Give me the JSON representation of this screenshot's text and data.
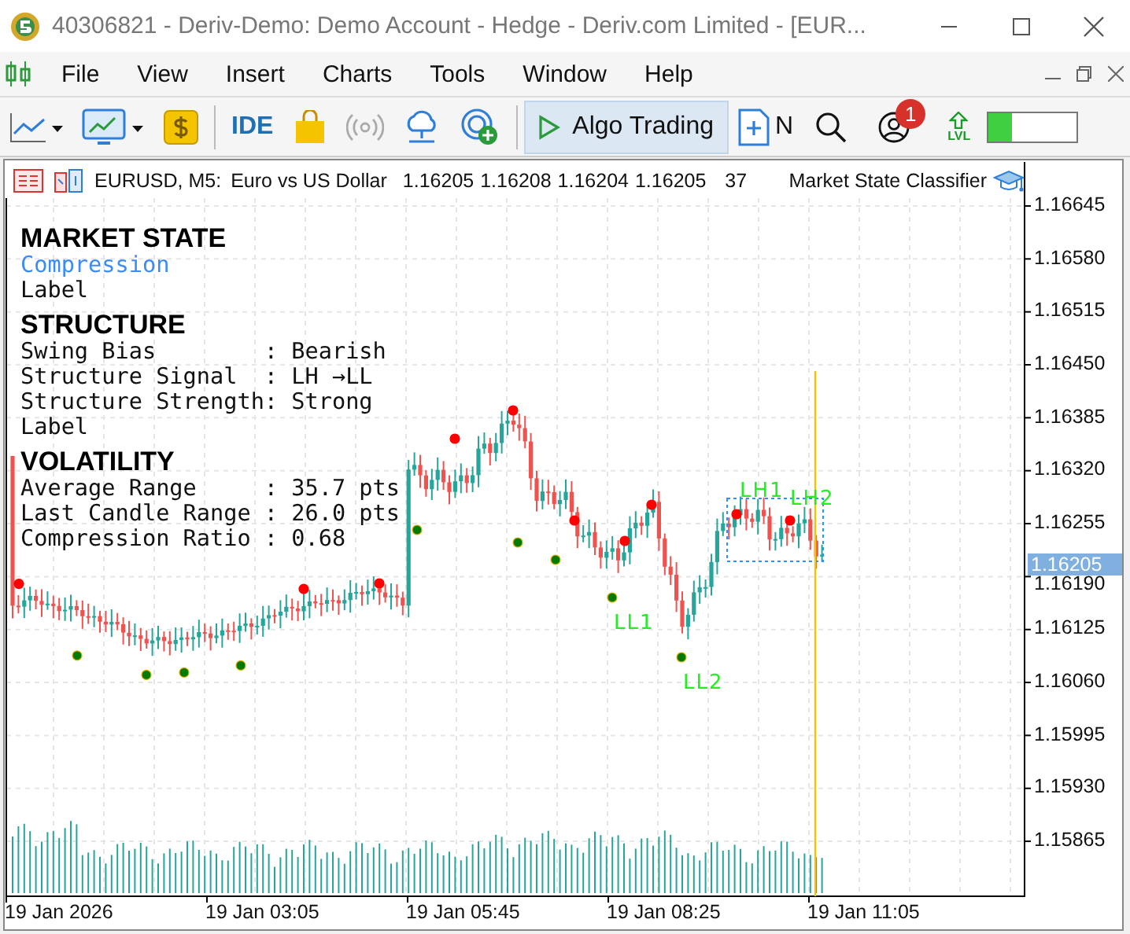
{
  "window": {
    "title": "40306821 - Deriv-Demo: Demo Account - Hedge - Deriv.com Limited - [EUR..."
  },
  "menu": [
    "File",
    "View",
    "Insert",
    "Charts",
    "Tools",
    "Window",
    "Help"
  ],
  "toolbar": {
    "ide_label": "IDE",
    "algo_trading": {
      "label": "Algo Trading",
      "selected": true
    },
    "new_order_label": "N",
    "notification_badge": "1",
    "lvl_label": "LVL",
    "meter": {
      "level": 0.28
    }
  },
  "chart": {
    "symbol": "EURUSD, M5:",
    "description": "Euro vs US Dollar",
    "quotes": [
      "1.16205",
      "1.16208",
      "1.16204",
      "1.16205"
    ],
    "tick_volume": "37",
    "indicator": "Market State Classifier",
    "price_axis": [
      "1.16645",
      "1.16580",
      "1.16515",
      "1.16450",
      "1.16385",
      "1.16320",
      "1.16255",
      "1.16190",
      "1.16125",
      "1.16060",
      "1.15995",
      "1.15930",
      "1.15865"
    ],
    "current_price": "1.16205",
    "time_axis": [
      "19 Jan 2026",
      "19 Jan 03:05",
      "19 Jan 05:45",
      "19 Jan 08:25",
      "19 Jan 11:05"
    ],
    "swing_labels": [
      "LH1",
      "LH2",
      "LL1",
      "LL2"
    ],
    "panel": [
      {
        "heading": "MARKET STATE",
        "lines": [
          {
            "kind": "state",
            "text": "Compression"
          },
          {
            "kind": "plain",
            "text": "Label"
          }
        ]
      },
      {
        "heading": "STRUCTURE",
        "lines": [
          {
            "kind": "plain",
            "text": "Swing Bias        : Bearish"
          },
          {
            "kind": "plain",
            "text": "Structure Signal  : LH →LL"
          },
          {
            "kind": "plain",
            "text": "Structure Strength: Strong"
          },
          {
            "kind": "plain",
            "text": "Label"
          }
        ]
      },
      {
        "heading": "VOLATILITY",
        "lines": [
          {
            "kind": "plain",
            "text": "Average Range     : 35.7 pts"
          },
          {
            "kind": "plain",
            "text": "Last Candle Range : 26.0 pts"
          },
          {
            "kind": "plain",
            "text": "Compression Ratio : 0.68"
          }
        ]
      }
    ]
  }
}
